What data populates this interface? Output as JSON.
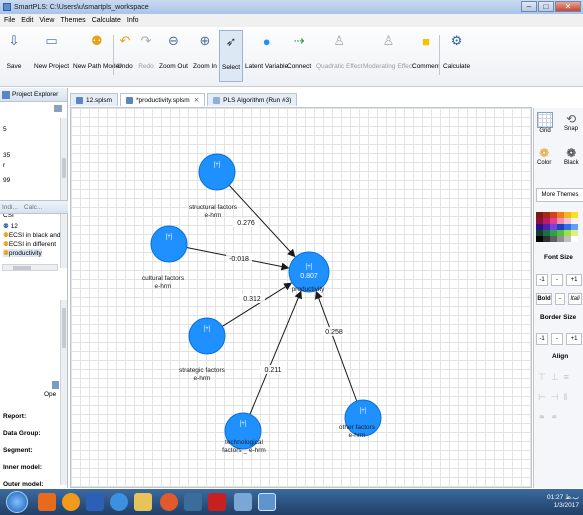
{
  "window": {
    "title": "SmartPLS: C:\\Users\\u\\smartpls_workspace"
  },
  "menu": [
    "File",
    "Edit",
    "View",
    "Themes",
    "Calculate",
    "Info"
  ],
  "toolbar": {
    "save": "Save",
    "new_project": "New Project",
    "new_path_model": "New Path Model",
    "undo": "Undo",
    "redo": "Redo",
    "zoom_out": "Zoom Out",
    "zoom_in": "Zoom In",
    "select": "Select",
    "latent_variable": "Latent Variable",
    "connect": "Connect",
    "quadratic_effect": "Quadratic Effect",
    "moderating_effect": "Moderating Effect",
    "comment": "Comment",
    "calculate": "Calculate"
  },
  "explorer": {
    "tab": "Project Explorer",
    "rows": [
      "5",
      "35",
      "r",
      "99",
      "CSI",
      "12",
      "ECSI in black and",
      "ECSI in different",
      "productivity"
    ],
    "tab2a": "Indi...",
    "tab2b": "Calc..."
  },
  "properties": {
    "open_label": "Ope",
    "labels": [
      "Report:",
      "Data Group:",
      "Segment:",
      "Inner model:",
      "Outer model:"
    ]
  },
  "editor": {
    "tabs": [
      "12.splsm",
      "*productivity.splsm",
      "PLS Algorithm (Run #3)"
    ]
  },
  "model": {
    "node_marker": "[+]",
    "nodes": [
      {
        "id": "structural",
        "label_line1": "structural factors",
        "label_line2": "e-hrm"
      },
      {
        "id": "cultural",
        "label_line1": "cultural factors",
        "label_line2": "e-hrm"
      },
      {
        "id": "strategic",
        "label_line1": "strategic factors",
        "label_line2": "e-hrm"
      },
      {
        "id": "technological",
        "label_line1": "technological",
        "label_line2": "factors _ e-hrm"
      },
      {
        "id": "other",
        "label_line1": "other factors",
        "label_line2": "e-hrm"
      },
      {
        "id": "productivity",
        "label_line1": "productivity",
        "label_line2": "",
        "r2": "0.807"
      }
    ],
    "paths": [
      {
        "from": "structural",
        "coef": "0.276"
      },
      {
        "from": "cultural",
        "coef": "-0.018"
      },
      {
        "from": "strategic",
        "coef": "0.312"
      },
      {
        "from": "technological",
        "coef": "0.211"
      },
      {
        "from": "other",
        "coef": "0.258"
      }
    ],
    "colors": {
      "node": "#1e90ff",
      "node_stroke": "#0a6fd8",
      "line": "#1a1a1a"
    }
  },
  "palette": {
    "grid": "Grid",
    "snap": "Snap",
    "color": "Color",
    "black": "Black",
    "more_themes": "More Themes",
    "font_size": "Font Size",
    "border_size": "Border Size",
    "align": "Align",
    "minus": "-1",
    "dash": "-",
    "plus": "+1",
    "bold": "Bold",
    "italic": "Itali"
  },
  "taskbar": {
    "time": "01:27 ب.ظ",
    "date": "1/3/2017"
  }
}
